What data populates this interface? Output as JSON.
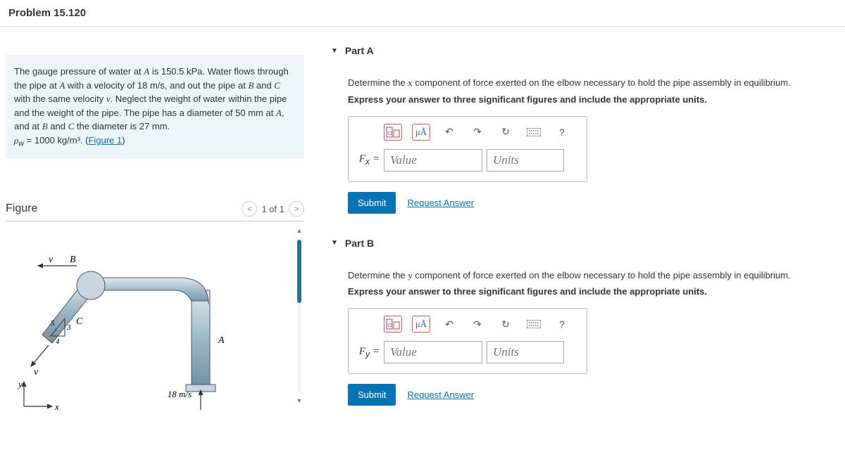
{
  "header": {
    "title": "Problem 15.120"
  },
  "problem": {
    "text_html": "The gauge pressure of water at <span class='var'>A</span> is 150.5 kPa. Water flows through the pipe at <span class='var'>A</span> with a velocity of 18 m/s, and out the pipe at <span class='var'>B</span> and <span class='var'>C</span> with the same velocity <span class='var'>v</span>. Neglect the weight of water within the pipe and the weight of the pipe. The pipe has a diameter of 50 mm at <span class='var'>A</span>, and at <span class='var'>B</span> and <span class='var'>C</span> the diameter is 27 mm. <br><span class='var'>ρ<sub>w</sub></span> = 1000 kg/m³. (<span class='link' data-name='figure-link' data-interactable='true'>Figure 1</span>)"
  },
  "figure": {
    "title": "Figure",
    "pager": "1 of 1",
    "labels": {
      "A": "A",
      "B": "B",
      "C": "C",
      "v": "v",
      "x": "x",
      "y": "y",
      "vel": "18 m/s",
      "r3": "3",
      "r4": "4",
      "r5": "5"
    }
  },
  "parts": {
    "A": {
      "title": "Part A",
      "prompt_html": "Determine the <span class='var' style='font-family:Times New Roman'>x</span> component of force exerted on the elbow necessary to hold the pipe assembly in equilibrium.",
      "instruct": "Express your answer to three significant figures and include the appropriate units.",
      "lhs_html": "F<sub>x</sub> =",
      "value_ph": "Value",
      "units_ph": "Units",
      "submit": "Submit",
      "request": "Request Answer"
    },
    "B": {
      "title": "Part B",
      "prompt_html": "Determine the <span class='var' style='font-family:Times New Roman'>y</span> component of force exerted on the elbow necessary to hold the pipe assembly in equilibrium.",
      "instruct": "Express your answer to three significant figures and include the appropriate units.",
      "lhs_html": "F<sub>y</sub> =",
      "value_ph": "Value",
      "units_ph": "Units",
      "submit": "Submit",
      "request": "Request Answer"
    }
  },
  "toolbar": {
    "mu": "μÅ",
    "help": "?"
  }
}
